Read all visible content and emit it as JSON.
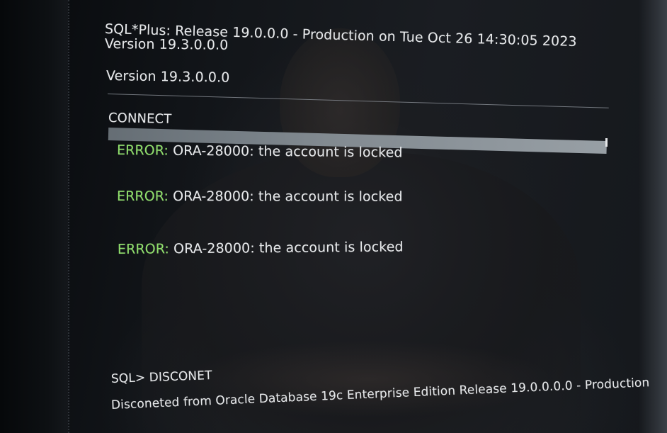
{
  "terminal": {
    "banner_line1": "SQL*Plus: Release 19.0.0.0 - Production on Tue Oct 26 14:30:05 2023",
    "banner_line2": "Version 19.3.0.0.0",
    "version_line": "Version 19.3.0.0.0",
    "connect_label": "CONNECT",
    "errors": [
      {
        "keyword": "ERROR:",
        "message": " ORA-28000: the account is locked"
      },
      {
        "keyword": "ERROR:",
        "message": " ORA-28000: the account is locked"
      },
      {
        "keyword": "ERROR:",
        "message": " ORA-28000: the account is locked"
      }
    ],
    "prompt_command": "SQL> DISCONET",
    "disconnect_message": "Disconeted from Oracle Database 19c Enterprise Edition Release 19.0.0.0.0 - Production"
  },
  "colors": {
    "error_keyword": "#8fe06a",
    "text": "#e6e8ea",
    "background": "#0b0e12"
  }
}
